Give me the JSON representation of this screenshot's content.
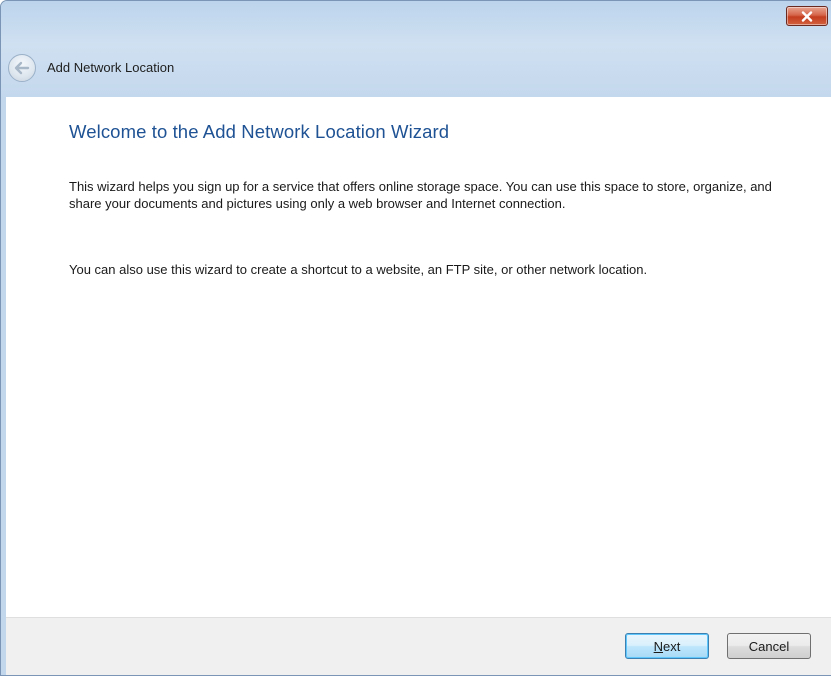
{
  "window": {
    "title": "Add Network Location"
  },
  "icons": {
    "back": "back-arrow-icon",
    "close": "close-icon"
  },
  "content": {
    "heading": "Welcome to the Add Network Location Wizard",
    "paragraph1": "This wizard helps you sign up for a service that offers online storage space.  You can use this space to store, organize, and share your documents and pictures using only a web browser and Internet connection.",
    "paragraph2": "You can also use this wizard to create a shortcut to a website, an FTP site, or other network location."
  },
  "footer": {
    "next_mnemonic": "N",
    "next_rest": "ext",
    "cancel_label": "Cancel"
  },
  "colors": {
    "heading": "#1e5294",
    "titlebar": "#c4d8ed",
    "close_button": "#c43d1f"
  }
}
